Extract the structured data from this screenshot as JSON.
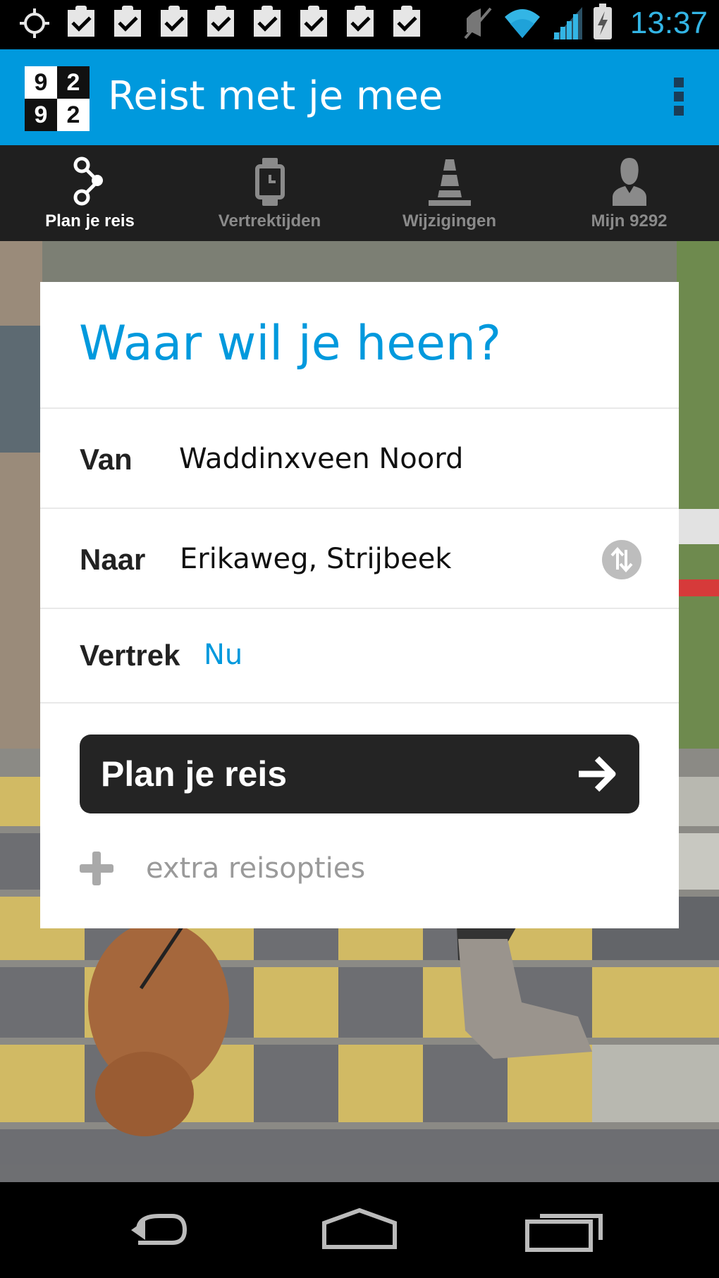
{
  "status_bar": {
    "time": "13:37",
    "notification_icons": [
      "target-icon",
      "checkbox-icon",
      "checkbox-icon",
      "checkbox-icon",
      "checkbox-icon",
      "checkbox-icon",
      "checkbox-icon",
      "checkbox-icon",
      "checkbox-icon"
    ],
    "system_icons": [
      "mute-icon",
      "wifi-icon",
      "signal-icon",
      "battery-charging-icon"
    ],
    "accent_color": "#33b5e5"
  },
  "app_bar": {
    "logo_digits": [
      "9",
      "2",
      "9",
      "2"
    ],
    "title": "Reist met je mee",
    "background": "#0099dd"
  },
  "tabs": [
    {
      "label": "Plan je reis",
      "icon": "route-icon",
      "active": true
    },
    {
      "label": "Vertrektijden",
      "icon": "watch-icon",
      "active": false
    },
    {
      "label": "Wijzigingen",
      "icon": "traffic-cone-icon",
      "active": false
    },
    {
      "label": "Mijn 9292",
      "icon": "person-icon",
      "active": false
    }
  ],
  "card": {
    "title": "Waar wil je heen?",
    "from_label": "Van",
    "from_value": "Waddinxveen Noord",
    "to_label": "Naar",
    "to_value": "Erikaweg, Strijbeek",
    "depart_label": "Vertrek",
    "depart_value": "Nu",
    "plan_button_label": "Plan je reis",
    "extra_options_label": "extra reisopties"
  },
  "navigation": [
    "back-icon",
    "home-icon",
    "recent-apps-icon"
  ]
}
